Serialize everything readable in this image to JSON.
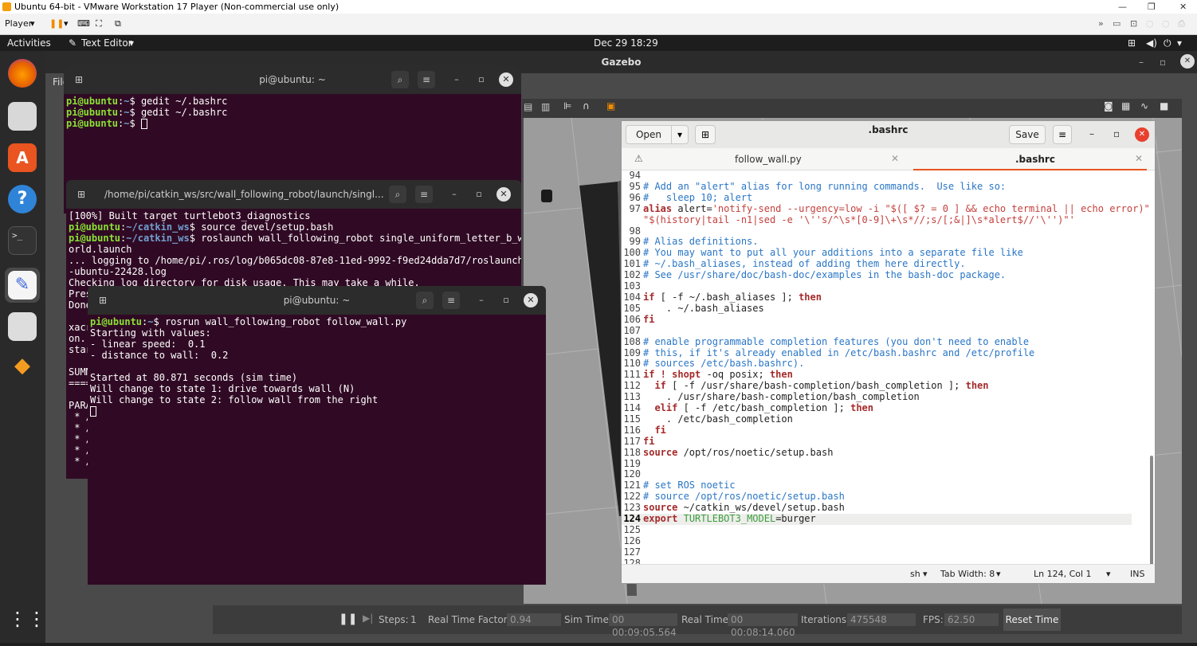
{
  "vmware": {
    "title": "Ubuntu 64-bit - VMware Workstation 17 Player (Non-commercial use only)",
    "player_menu": "Player"
  },
  "topbar": {
    "activities": "Activities",
    "app_menu": "Text Editor",
    "clock": "Dec 29  18:29"
  },
  "gazebo": {
    "title": "Gazebo",
    "steps_label": "Steps:",
    "steps_value": "1",
    "rtf_label": "Real Time Factor:",
    "rtf_value": "0.94",
    "sim_time_label": "Sim Time:",
    "sim_time_value": "00 00:09:05.564",
    "real_time_label": "Real Time:",
    "real_time_value": "00 00:08:14.060",
    "iterations_label": "Iterations:",
    "iterations_value": "475548",
    "fps_label": "FPS:",
    "fps_value": "62.50",
    "reset_label": "Reset Time",
    "file_menu": "File"
  },
  "term1": {
    "title": "pi@ubuntu: ~",
    "lines": [
      {
        "prompt": "pi@ubuntu",
        "path": "~",
        "cmd": "$ gedit ~/.bashrc"
      },
      {
        "prompt": "pi@ubuntu",
        "path": "~",
        "cmd": "$ gedit ~/.bashrc"
      },
      {
        "prompt": "pi@ubuntu",
        "path": "~",
        "cmd": "$ "
      }
    ]
  },
  "term2": {
    "title": "/home/pi/catkin_ws/src/wall_following_robot/launch/singl...",
    "text": [
      "[100%] Built target turtlebot3_diagnostics",
      "$ source devel/setup.bash",
      "$ roslaunch wall_following_robot single_uniform_letter_b_w",
      "orld.launch",
      "... logging to /home/pi/.ros/log/b065dc08-87e8-11ed-9992-f9ed24dda7d7/roslaunch",
      "-ubuntu-22428.log",
      "Checking log directory for disk usage. This may take a while.",
      "Pres",
      "Done",
      "",
      "xacr",
      "on.",
      "star",
      "",
      "SUMM",
      "====",
      "",
      "PARA",
      " * /",
      " * /",
      " * /",
      " * /",
      " * /"
    ],
    "prompt": "pi@ubuntu",
    "path": "~/catkin_ws"
  },
  "term3": {
    "title": "pi@ubuntu: ~",
    "prompt": "pi@ubuntu",
    "path": "~",
    "cmd": "$ rosrun wall_following_robot follow_wall.py",
    "lines": [
      "Starting with values:",
      "- linear speed:  0.1",
      "- distance to wall:  0.2",
      "",
      "Started at 80.871 seconds (sim time)",
      "Will change to state 1: drive towards wall (N)",
      "Will change to state 2: follow wall from the right"
    ]
  },
  "gedit": {
    "open_label": "Open",
    "save_label": "Save",
    "title": ".bashrc",
    "tabs": [
      {
        "label": "follow_wall.py",
        "active": false
      },
      {
        "label": ".bashrc",
        "active": true
      }
    ],
    "status": {
      "lang": "sh",
      "tab_width": "Tab Width: 8",
      "position": "Ln 124, Col 1",
      "mode": "INS"
    }
  }
}
